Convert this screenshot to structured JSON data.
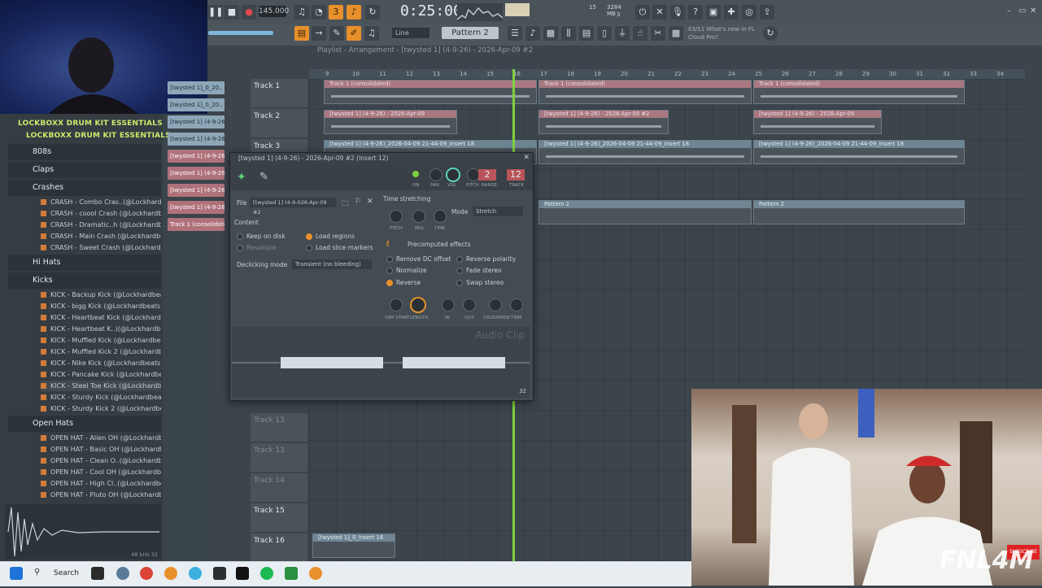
{
  "transport": {
    "tempo": "145.000",
    "time": "0:25:00",
    "memory": "3284 MB",
    "cpu_value": "15",
    "cpu_sub": "3"
  },
  "toolbar": {
    "pattern": "Pattern 2",
    "snap": "Line",
    "news": "03/11 What's new in FL Cloud Pro?"
  },
  "playlist": {
    "title": "Playlist - Arrangement - [twysted 1] (4-9-26) - 2026-Apr-09 #2",
    "ruler": [
      "9",
      "10",
      "11",
      "12",
      "13",
      "14",
      "15",
      "16",
      "17",
      "18",
      "19",
      "20",
      "21",
      "22",
      "23",
      "24",
      "25",
      "26",
      "27",
      "28",
      "29",
      "30",
      "31",
      "32",
      "33",
      "34"
    ],
    "tracks": [
      "Track 1",
      "Track 2",
      "Track 3",
      "Track 13",
      "Track 13",
      "Track 14",
      "Track 15",
      "Track 16"
    ],
    "clips_consolidated": "Track 1 (consolidated)",
    "clip_twysted": "[twysted 1] (4-9-26) - 2026-Apr-09",
    "clip_twysted2": "[twysted 1] (4-9-26) - 2026-Apr-09 #2",
    "clip_insert": "[twysted 1] (4-9-26)_2026-04-09 21-44-09_Insert 18",
    "clip_pattern": "Pattern 2",
    "clip_bottom": "[twysted 1]_0_Insert 16"
  },
  "clip_list": [
    "[twysted 1]_0_20..",
    "[twysted 1]_0_20..",
    "[twysted 1] (4-9-26)_20..",
    "[twysted 1] (4-9-26)..",
    "[twysted 1] (4-9-26)..",
    "[twysted 1] (4-9-26)..",
    "[twysted 1] (4-9-26)..",
    "[twysted 1] (4-9-26)..",
    "Track 1 (consolidated)"
  ],
  "browser": {
    "header1": "LOCKBOXX DRUM KIT ESSENTIALS",
    "header2": "LOCKBOXX DRUM KIT ESSENTIALS",
    "folders": [
      "808s",
      "Claps",
      "Crashes",
      "Hi Hats",
      "Kicks",
      "Open Hats"
    ],
    "crashes": [
      "CRASH - Combo Cras..(@Lockhardbeats)",
      "CRASH - coool Crash (@Lockhardbeats)",
      "CRASH - Dramatic..h (@Lockhardbeats)",
      "CRASH - Main Crash (@Lockhardbeats)",
      "CRASH - Sweet Crash (@Lockhardbeats)"
    ],
    "kicks": [
      "KICK - Backup Kick (@Lockhardbeats)",
      "KICK - bigg Kick (@Lockhardbeats)",
      "KICK - Heartbeat Kick (@Lockhardbeats)",
      "KICK - Heartbeat K..)(@Lockhardbeats)",
      "KICK - Muffled Kick (@Lockhardbeats)",
      "KICK - Muffled Kick 2 (@Lockhardbeats)",
      "KICK - Nike Kick (@Lockhardbeats)",
      "KICK - Pancake Kick (@Lockhardbeats)",
      "KICK - Steel Toe Kick (@Lockhardbeats)",
      "KICK - Sturdy Kick (@Lockhardbeats)",
      "KICK - Sturdy Kick 2 (@Lockhardbeats)"
    ],
    "openhats": [
      "OPEN HAT - Alien OH (@Lockhardbeats)",
      "OPEN HAT - Basic OH (@Lockhardbeats)",
      "OPEN HAT - Clean O..(@Lockhardbeats)",
      "OPEN HAT - Cool OH (@Lockhardbeats)",
      "OPEN HAT - High Cl..(@Lockhardbeats)",
      "OPEN HAT - Pluto OH (@Lockhardbeats)"
    ],
    "preview_info": "48 kHz 32"
  },
  "audio_clip": {
    "title": "[twysted 1] (4-9-26) - 2026-Apr-09 #2 (Insert 12)",
    "file_label": "File",
    "file_value": "[twysted 1] (4-9-026-Apr-09 #2",
    "content_label": "Content",
    "keep_on_disk": "Keep on disk",
    "load_regions": "Load regions",
    "resample": "Resample",
    "load_slice": "Load slice markers",
    "declick_label": "Declicking mode",
    "declick_value": "Transient (no bleeding)",
    "stretch_label": "Time stretching",
    "mode_label": "Mode",
    "mode_value": "Stretch",
    "precomputed": "Precomputed effects",
    "fx": [
      "Remove DC offset",
      "Normalize",
      "Reverse",
      "Reverse polarity",
      "Fade stereo",
      "Swap stereo"
    ],
    "knob_labels": [
      "SMP START",
      "LENGTH",
      "IN",
      "OUT",
      "CROSSFADE",
      "TRIM"
    ],
    "stretch_knobs": [
      "PITCH",
      "MUL",
      "TIME"
    ],
    "head_labels": [
      "ON",
      "PAN",
      "VOL",
      "PITCH",
      "RANGE",
      "TRACK"
    ],
    "range_value": "2",
    "track_value": "12",
    "watermark": "Audio Clip",
    "footer": "32"
  },
  "taskbar": {
    "search": "Search"
  },
  "overlay": {
    "logo": "FNL4M",
    "subscribe": "SUBSCRIBE"
  }
}
